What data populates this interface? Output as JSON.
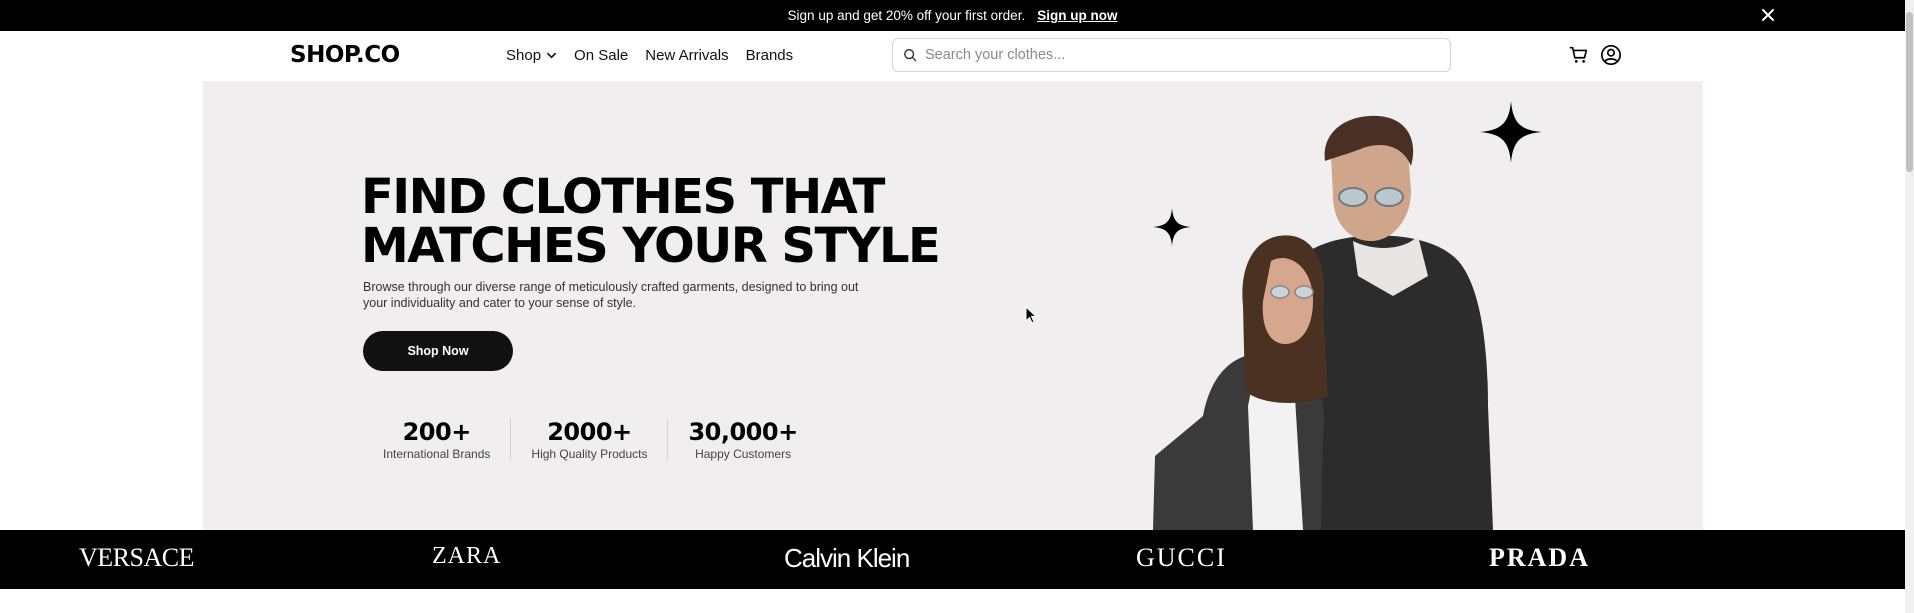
{
  "promo": {
    "text": "Sign up and get 20% off your first order.",
    "link": "Sign up now"
  },
  "nav": {
    "logo": "SHOP.CO",
    "menu": {
      "shop": "Shop",
      "on_sale": "On Sale",
      "new_arrivals": "New Arrivals",
      "brands": "Brands"
    },
    "search_placeholder": "Search your clothes..."
  },
  "hero": {
    "headline_line1": "FIND CLOTHES THAT",
    "headline_line2": "MATCHES YOUR STYLE",
    "subtext": "Browse through our diverse range of meticulously crafted garments, designed to bring out your individuality and cater to your sense of style.",
    "cta": "Shop Now",
    "stats": [
      {
        "value": "200+",
        "label": "International Brands"
      },
      {
        "value": "2000+",
        "label": "High Quality Products"
      },
      {
        "value": "30,000+",
        "label": "Happy Customers"
      }
    ]
  },
  "brands": [
    "VERSACE",
    "ZARA",
    "Calvin Klein",
    "GUCCI",
    "PRADA"
  ],
  "icons": [
    "close-icon",
    "chevron-down-icon",
    "search-icon",
    "cart-icon",
    "account-icon",
    "sparkle-icon"
  ],
  "colors": {
    "accent": "#000000",
    "hero_bg": "#f0eeef"
  }
}
